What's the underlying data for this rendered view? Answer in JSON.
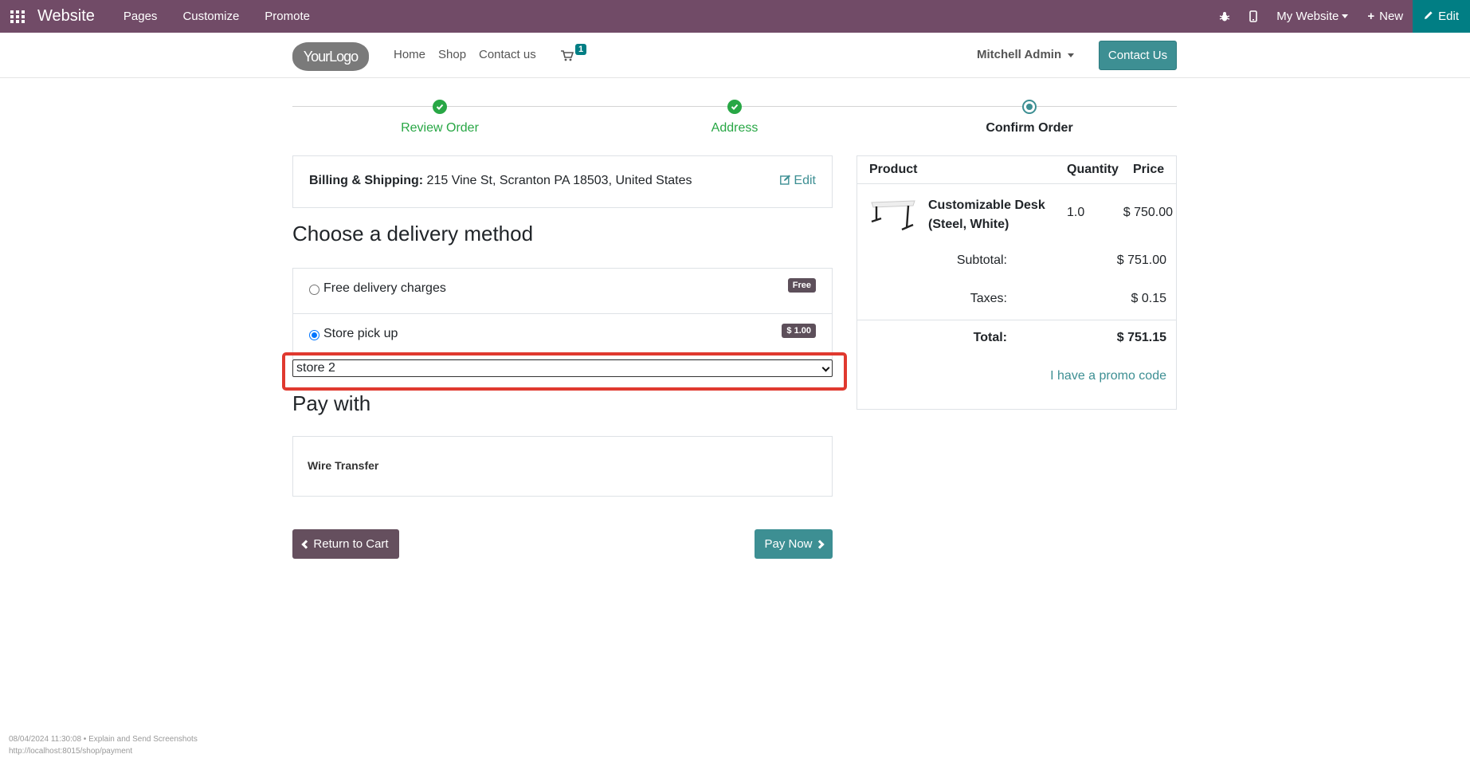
{
  "admin_bar": {
    "brand": "Website",
    "menus": [
      "Pages",
      "Customize",
      "Promote"
    ],
    "my_website": "My Website",
    "new_label": "New",
    "edit_label": "Edit",
    "bg_color": "#714b67"
  },
  "site_header": {
    "logo_text": "YourLogo",
    "nav": [
      "Home",
      "Shop",
      "Contact us"
    ],
    "cart_count": "1",
    "user": "Mitchell Admin",
    "contact_button": "Contact Us"
  },
  "wizard": {
    "steps": [
      {
        "label": "Review Order",
        "state": "done"
      },
      {
        "label": "Address",
        "state": "done"
      },
      {
        "label": "Confirm Order",
        "state": "current"
      }
    ]
  },
  "billing": {
    "label": "Billing & Shipping:",
    "address": "215 Vine St, Scranton PA 18503, United States",
    "edit_label": "Edit"
  },
  "delivery": {
    "title": "Choose a delivery method",
    "methods": [
      {
        "label": "Free delivery charges",
        "badge": "Free",
        "selected": false
      },
      {
        "label": "Store pick up",
        "badge": "$ 1.00",
        "selected": true
      }
    ],
    "store_select": "store 2"
  },
  "payment": {
    "title": "Pay with",
    "method": "Wire Transfer"
  },
  "buttons": {
    "return": "Return to Cart",
    "pay": "Pay Now"
  },
  "summary": {
    "headers": {
      "product": "Product",
      "quantity": "Quantity",
      "price": "Price"
    },
    "item": {
      "name": "Customizable Desk (Steel, White)",
      "qty": "1.0",
      "price": "$ 750.00"
    },
    "subtotal_label": "Subtotal:",
    "subtotal": "$ 751.00",
    "taxes_label": "Taxes:",
    "taxes": "$ 0.15",
    "total_label": "Total:",
    "total": "$ 751.15",
    "promo": "I have a promo code"
  },
  "footnote": {
    "line1": "08/04/2024 11:30:08 • Explain and Send Screenshots",
    "line2": "http://localhost:8015/shop/payment"
  }
}
